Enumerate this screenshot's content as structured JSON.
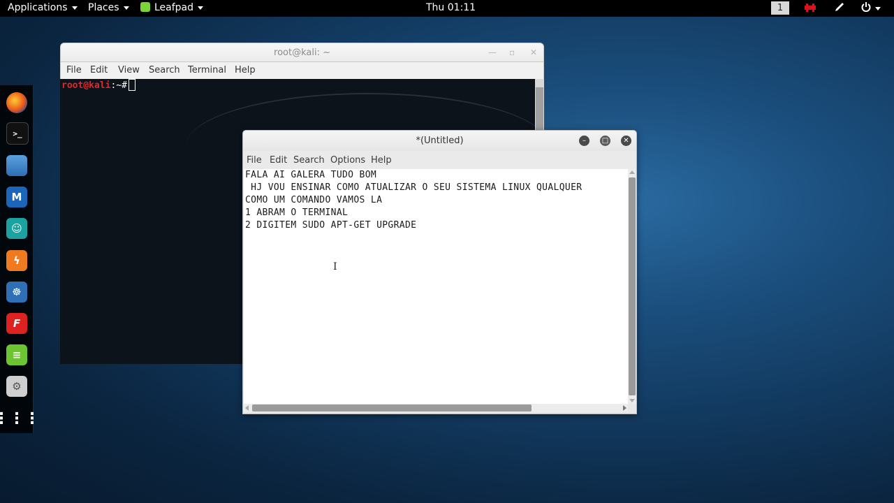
{
  "top_panel": {
    "applications": "Applications",
    "places": "Places",
    "active_app": "Leafpad",
    "clock": "Thu 01:11",
    "workspace": "1"
  },
  "dock": {
    "items": [
      "firefox-icon",
      "terminal-icon",
      "files-icon",
      "metasploit-icon",
      "armitage-icon",
      "burpsuite-icon",
      "beef-icon",
      "faraday-icon",
      "leafpad-icon",
      "settings-icon",
      "show-apps-icon"
    ]
  },
  "terminal": {
    "title": "root@kali: ~",
    "menu": [
      "File",
      "Edit",
      "View",
      "Search",
      "Terminal",
      "Help"
    ],
    "prompt_user": "root@kali",
    "prompt_rest": ":~#"
  },
  "leafpad": {
    "title": "*(Untitled)",
    "menu": [
      "File",
      "Edit",
      "Search",
      "Options",
      "Help"
    ],
    "lines": [
      "FALA AI GALERA TUDO BOM",
      " HJ VOU ENSINAR COMO ATUALIZAR O SEU SISTEMA LINUX QUALQUER",
      "COMO UM COMANDO VAMOS LA",
      "1 ABRAM O TERMINAL",
      "2 DIGITEM SUDO APT-GET UPGRADE"
    ]
  }
}
